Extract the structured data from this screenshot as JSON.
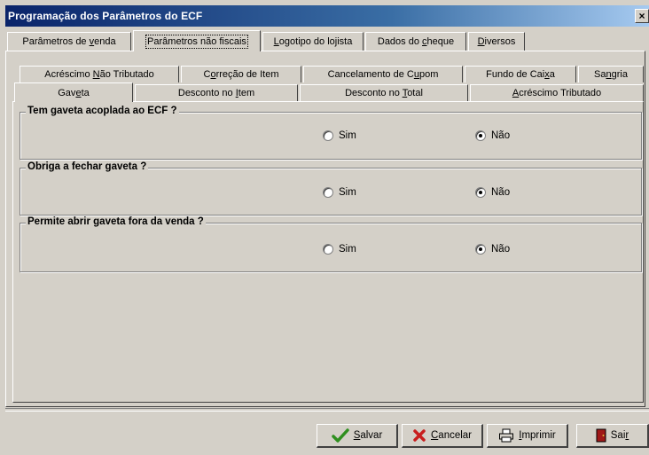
{
  "window": {
    "title": "Programação dos Parâmetros do ECF",
    "close_label": "×"
  },
  "outer_tabs": [
    {
      "label": "Parâmetros de venda"
    },
    {
      "label": "Parâmetros não fiscais"
    },
    {
      "label": "Logotipo do lojista"
    },
    {
      "label": "Dados do cheque"
    },
    {
      "label": "Diversos"
    }
  ],
  "inner_tabs_row1": [
    {
      "label": "Acréscimo Não Tributado"
    },
    {
      "label": "Correção de  Item"
    },
    {
      "label": "Cancelamento de Cupom"
    },
    {
      "label": "Fundo de Caixa"
    },
    {
      "label": "Sangria"
    }
  ],
  "inner_tabs_row2": [
    {
      "label": "Gaveta"
    },
    {
      "label": "Desconto no Item"
    },
    {
      "label": "Desconto no Total"
    },
    {
      "label": "Acréscimo Tributado"
    }
  ],
  "groups": [
    {
      "title": "Tem gaveta acoplada ao ECF ?",
      "option_sim": "Sim",
      "option_nao": "Não",
      "selected": "Não"
    },
    {
      "title": "Obriga a fechar gaveta ?",
      "option_sim": "Sim",
      "option_nao": "Não",
      "selected": "Não"
    },
    {
      "title": "Permite abrir gaveta fora da venda ?",
      "option_sim": "Sim",
      "option_nao": "Não",
      "selected": "Não"
    }
  ],
  "buttons": {
    "save": "Salvar",
    "cancel": "Cancelar",
    "print": "Imprimir",
    "exit": "Sair"
  }
}
